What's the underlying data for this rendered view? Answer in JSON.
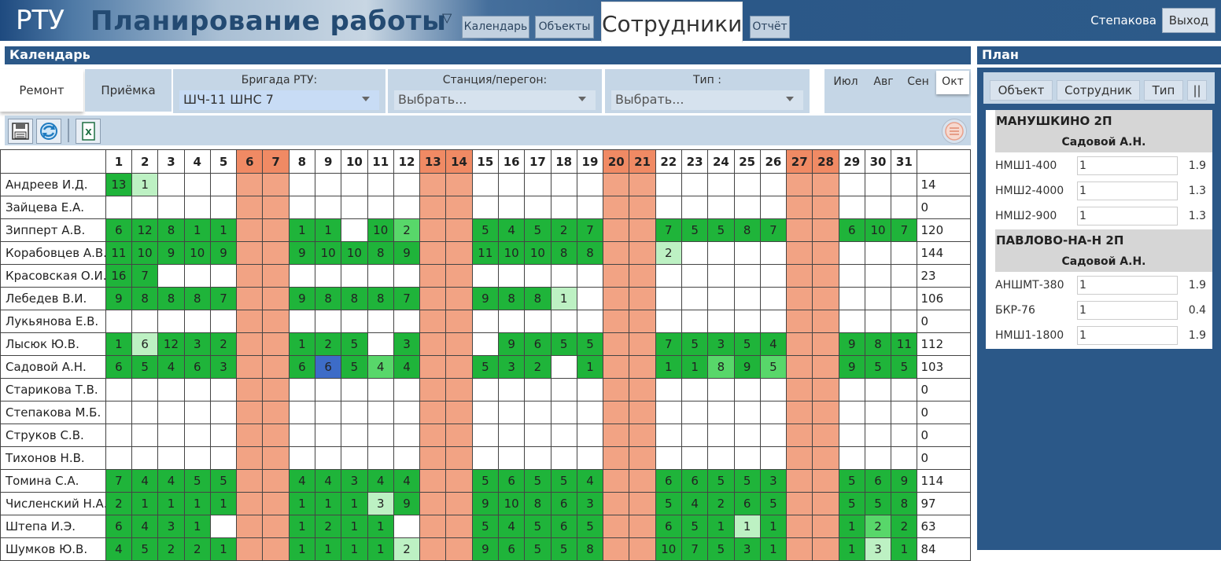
{
  "header": {
    "brand": "РТУ",
    "title": "Планирование работы",
    "nav": [
      "Календарь",
      "Объекты"
    ],
    "nav_active": "Сотрудники",
    "nav_report": "Отчёт",
    "user": "Степакова",
    "logout": "Выход"
  },
  "calendar": {
    "title": "Календарь",
    "tabs": [
      "Ремонт",
      "Приёмка"
    ],
    "filters": {
      "brigade_label": "Бригада РТУ:",
      "brigade_value": "ШЧ-11 ШНС  7",
      "station_label": "Станция/перегон:",
      "station_value": "Выбрать...",
      "type_label": "Тип :",
      "type_value": "Выбрать..."
    },
    "months": [
      "Июл",
      "Авг",
      "Сен",
      "Окт"
    ],
    "active_month": "Окт",
    "days": [
      1,
      2,
      3,
      4,
      5,
      6,
      7,
      8,
      9,
      10,
      11,
      12,
      13,
      14,
      15,
      16,
      17,
      18,
      19,
      20,
      21,
      22,
      23,
      24,
      25,
      26,
      27,
      28,
      29,
      30,
      31
    ],
    "weekend_days": [
      6,
      7,
      13,
      14,
      20,
      21,
      27,
      28
    ],
    "rows": [
      {
        "name": "Андреев И.Д.",
        "cells": {
          "1": [
            13,
            3
          ],
          "2": [
            1,
            1
          ]
        },
        "total": "14"
      },
      {
        "name": "Зайцева Е.А.",
        "cells": {},
        "total": "0"
      },
      {
        "name": "Зипперт А.В.",
        "cells": {
          "1": [
            6,
            3
          ],
          "2": [
            12,
            3
          ],
          "3": [
            8,
            3
          ],
          "4": [
            1,
            3
          ],
          "5": [
            1,
            3
          ],
          "8": [
            1,
            3
          ],
          "9": [
            1,
            3
          ],
          "11": [
            10,
            3
          ],
          "12": [
            2,
            2
          ],
          "15": [
            5,
            3
          ],
          "16": [
            4,
            3
          ],
          "17": [
            5,
            3
          ],
          "18": [
            2,
            3
          ],
          "19": [
            7,
            3
          ],
          "22": [
            7,
            3
          ],
          "23": [
            5,
            3
          ],
          "24": [
            5,
            3
          ],
          "25": [
            8,
            3
          ],
          "26": [
            7,
            3
          ],
          "29": [
            6,
            3
          ],
          "30": [
            10,
            3
          ],
          "31": [
            7,
            3
          ]
        },
        "total": "120"
      },
      {
        "name": "Корабовцев А.В.",
        "cells": {
          "1": [
            11,
            3
          ],
          "2": [
            10,
            3
          ],
          "3": [
            9,
            3
          ],
          "4": [
            10,
            3
          ],
          "5": [
            9,
            3
          ],
          "8": [
            9,
            3
          ],
          "9": [
            10,
            3
          ],
          "10": [
            10,
            3
          ],
          "11": [
            8,
            3
          ],
          "12": [
            9,
            3
          ],
          "15": [
            11,
            3
          ],
          "16": [
            10,
            3
          ],
          "17": [
            10,
            3
          ],
          "18": [
            8,
            3
          ],
          "19": [
            8,
            3
          ],
          "22": [
            2,
            1
          ]
        },
        "total": "144"
      },
      {
        "name": "Красовская О.И.",
        "cells": {
          "1": [
            16,
            3
          ],
          "2": [
            7,
            3
          ]
        },
        "total": "23"
      },
      {
        "name": "Лебедев В.И.",
        "cells": {
          "1": [
            9,
            3
          ],
          "2": [
            8,
            3
          ],
          "3": [
            8,
            3
          ],
          "4": [
            8,
            3
          ],
          "5": [
            7,
            3
          ],
          "8": [
            9,
            3
          ],
          "9": [
            8,
            3
          ],
          "10": [
            8,
            3
          ],
          "11": [
            8,
            3
          ],
          "12": [
            7,
            3
          ],
          "15": [
            9,
            3
          ],
          "16": [
            8,
            3
          ],
          "17": [
            8,
            3
          ],
          "18": [
            1,
            1
          ]
        },
        "total": "106"
      },
      {
        "name": "Лукьянова Е.В.",
        "cells": {},
        "total": "0"
      },
      {
        "name": "Лысюк Ю.В.",
        "cells": {
          "1": [
            1,
            3
          ],
          "2": [
            6,
            1
          ],
          "3": [
            12,
            3
          ],
          "4": [
            3,
            3
          ],
          "5": [
            2,
            3
          ],
          "8": [
            1,
            3
          ],
          "9": [
            2,
            3
          ],
          "10": [
            5,
            3
          ],
          "12": [
            3,
            3
          ],
          "16": [
            9,
            3
          ],
          "17": [
            6,
            3
          ],
          "18": [
            5,
            3
          ],
          "19": [
            5,
            3
          ],
          "22": [
            7,
            3
          ],
          "23": [
            5,
            3
          ],
          "24": [
            3,
            3
          ],
          "25": [
            5,
            3
          ],
          "26": [
            4,
            3
          ],
          "29": [
            9,
            3
          ],
          "30": [
            8,
            3
          ],
          "31": [
            11,
            3
          ]
        },
        "total": "112"
      },
      {
        "name": "Садовой А.Н.",
        "cells": {
          "1": [
            6,
            3
          ],
          "2": [
            5,
            3
          ],
          "3": [
            4,
            3
          ],
          "4": [
            6,
            3
          ],
          "5": [
            3,
            3
          ],
          "8": [
            6,
            3
          ],
          "9": [
            6,
            9
          ],
          "10": [
            5,
            3
          ],
          "11": [
            4,
            2
          ],
          "12": [
            4,
            3
          ],
          "15": [
            5,
            3
          ],
          "16": [
            3,
            3
          ],
          "17": [
            2,
            3
          ],
          "19": [
            1,
            3
          ],
          "22": [
            1,
            3
          ],
          "23": [
            1,
            3
          ],
          "24": [
            8,
            2
          ],
          "25": [
            9,
            3
          ],
          "26": [
            5,
            2
          ],
          "29": [
            9,
            3
          ],
          "30": [
            5,
            3
          ],
          "31": [
            5,
            3
          ]
        },
        "total": "103"
      },
      {
        "name": "Старикова Т.В.",
        "cells": {},
        "total": "0"
      },
      {
        "name": "Степакова М.Б.",
        "cells": {},
        "total": "0"
      },
      {
        "name": "Струков С.В.",
        "cells": {},
        "total": "0"
      },
      {
        "name": "Тихонов Н.В.",
        "cells": {},
        "total": "0"
      },
      {
        "name": "Томина С.А.",
        "cells": {
          "1": [
            7,
            3
          ],
          "2": [
            4,
            3
          ],
          "3": [
            4,
            3
          ],
          "4": [
            5,
            3
          ],
          "5": [
            5,
            3
          ],
          "8": [
            4,
            3
          ],
          "9": [
            4,
            3
          ],
          "10": [
            3,
            3
          ],
          "11": [
            4,
            3
          ],
          "12": [
            4,
            3
          ],
          "15": [
            5,
            3
          ],
          "16": [
            6,
            3
          ],
          "17": [
            5,
            3
          ],
          "18": [
            5,
            3
          ],
          "19": [
            4,
            3
          ],
          "22": [
            6,
            3
          ],
          "23": [
            6,
            3
          ],
          "24": [
            5,
            3
          ],
          "25": [
            5,
            3
          ],
          "26": [
            3,
            3
          ],
          "29": [
            5,
            3
          ],
          "30": [
            6,
            3
          ],
          "31": [
            9,
            3
          ]
        },
        "total": "114"
      },
      {
        "name": "Численский Н.А.",
        "cells": {
          "1": [
            2,
            3
          ],
          "2": [
            1,
            3
          ],
          "3": [
            1,
            3
          ],
          "4": [
            1,
            3
          ],
          "5": [
            1,
            3
          ],
          "8": [
            1,
            3
          ],
          "9": [
            1,
            3
          ],
          "10": [
            1,
            3
          ],
          "11": [
            3,
            1
          ],
          "12": [
            9,
            3
          ],
          "15": [
            9,
            3
          ],
          "16": [
            10,
            3
          ],
          "17": [
            8,
            3
          ],
          "18": [
            6,
            3
          ],
          "19": [
            3,
            3
          ],
          "22": [
            5,
            3
          ],
          "23": [
            4,
            3
          ],
          "24": [
            2,
            3
          ],
          "25": [
            6,
            3
          ],
          "26": [
            5,
            3
          ],
          "29": [
            5,
            3
          ],
          "30": [
            5,
            3
          ],
          "31": [
            8,
            3
          ]
        },
        "total": "97"
      },
      {
        "name": "Штепа И.Э.",
        "cells": {
          "1": [
            6,
            3
          ],
          "2": [
            4,
            3
          ],
          "3": [
            3,
            3
          ],
          "4": [
            1,
            3
          ],
          "8": [
            1,
            3
          ],
          "9": [
            2,
            3
          ],
          "10": [
            1,
            3
          ],
          "11": [
            1,
            3
          ],
          "15": [
            5,
            3
          ],
          "16": [
            4,
            3
          ],
          "17": [
            5,
            3
          ],
          "18": [
            6,
            3
          ],
          "19": [
            5,
            3
          ],
          "22": [
            6,
            3
          ],
          "23": [
            5,
            3
          ],
          "24": [
            1,
            3
          ],
          "25": [
            1,
            1
          ],
          "26": [
            1,
            3
          ],
          "29": [
            1,
            3
          ],
          "30": [
            2,
            2
          ],
          "31": [
            2,
            3
          ]
        },
        "total": "63"
      },
      {
        "name": "Шумков Ю.В.",
        "cells": {
          "1": [
            4,
            3
          ],
          "2": [
            5,
            3
          ],
          "3": [
            2,
            3
          ],
          "4": [
            2,
            3
          ],
          "5": [
            1,
            3
          ],
          "8": [
            1,
            3
          ],
          "9": [
            1,
            3
          ],
          "10": [
            1,
            3
          ],
          "11": [
            1,
            3
          ],
          "12": [
            2,
            1
          ],
          "15": [
            9,
            3
          ],
          "16": [
            6,
            3
          ],
          "17": [
            5,
            3
          ],
          "18": [
            5,
            3
          ],
          "19": [
            8,
            3
          ],
          "22": [
            10,
            3
          ],
          "23": [
            7,
            3
          ],
          "24": [
            5,
            3
          ],
          "25": [
            3,
            3
          ],
          "26": [
            1,
            3
          ],
          "29": [
            1,
            3
          ],
          "30": [
            3,
            1
          ],
          "31": [
            1,
            3
          ]
        },
        "total": "84"
      }
    ]
  },
  "plan": {
    "title": "План",
    "tabs": [
      "Объект",
      "Сотрудник",
      "Тип",
      "||"
    ],
    "groups": [
      {
        "object": "МАНУШКИНО 2П",
        "employee": "Садовой А.Н.",
        "items": [
          {
            "name": "НМШ1-400",
            "qty": "1",
            "val": "1.9"
          },
          {
            "name": "НМШ2-4000",
            "qty": "1",
            "val": "1.3"
          },
          {
            "name": "НМШ2-900",
            "qty": "1",
            "val": "1.3"
          }
        ]
      },
      {
        "object": "ПАВЛОВО-НА-Н 2П",
        "employee": "Садовой А.Н.",
        "items": [
          {
            "name": "АНШМТ-380",
            "qty": "1",
            "val": "1.9"
          },
          {
            "name": "БКР-76",
            "qty": "1",
            "val": "0.4"
          },
          {
            "name": "НМШ1-1800",
            "qty": "1",
            "val": "1.9"
          }
        ]
      }
    ]
  },
  "icons": {
    "save": "save-icon",
    "refresh": "refresh-icon",
    "excel": "excel-icon",
    "menu": "menu-icon",
    "dropdown": "chevron-down-icon"
  }
}
